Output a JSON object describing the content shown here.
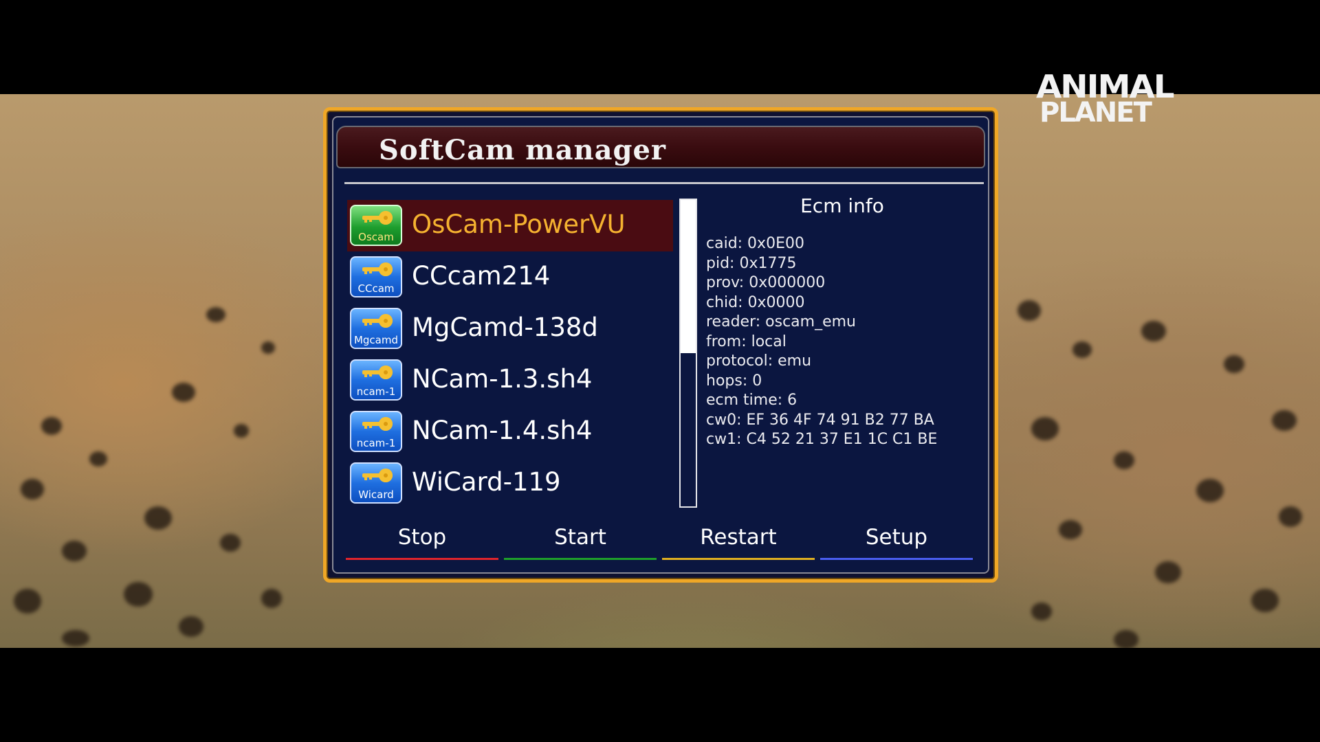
{
  "channel_logo": {
    "line1": "ANIMAL",
    "line2": "PLANET"
  },
  "dialog": {
    "title": "SoftCam manager",
    "cams": [
      {
        "name": "OsCam-PowerVU",
        "icon_label": "Oscam",
        "icon": "key-icon",
        "icon_color": "#1e9e2e",
        "selected": true
      },
      {
        "name": "CCcam214",
        "icon_label": "CCcam",
        "icon": "key-icon",
        "icon_color": "#1f6fe0",
        "selected": false
      },
      {
        "name": "MgCamd-138d",
        "icon_label": "Mgcamd",
        "icon": "key-icon",
        "icon_color": "#1f6fe0",
        "selected": false
      },
      {
        "name": "NCam-1.3.sh4",
        "icon_label": "ncam-1",
        "icon": "key-icon",
        "icon_color": "#1f6fe0",
        "selected": false
      },
      {
        "name": "NCam-1.4.sh4",
        "icon_label": "ncam-1",
        "icon": "key-icon",
        "icon_color": "#1f6fe0",
        "selected": false
      },
      {
        "name": "WiCard-119",
        "icon_label": "Wicard",
        "icon": "key-icon",
        "icon_color": "#1f6fe0",
        "selected": false
      }
    ],
    "scroll_position": 0.5,
    "ecm_info": {
      "title": "Ecm info",
      "lines": [
        "caid: 0x0E00",
        "pid: 0x1775",
        "prov: 0x000000",
        "chid: 0x0000",
        "reader: oscam_emu",
        "from: local",
        "protocol: emu",
        "hops: 0",
        "ecm time: 6",
        "cw0: EF 36 4F 74 91 B2 77 BA",
        "cw1: C4 52 21 37 E1 1C C1 BE"
      ]
    },
    "buttons": [
      {
        "label": "Stop",
        "color": "#e0242c"
      },
      {
        "label": "Start",
        "color": "#1ea02a"
      },
      {
        "label": "Restart",
        "color": "#e0b020"
      },
      {
        "label": "Setup",
        "color": "#4a5ef0"
      }
    ],
    "accent_color": "#f0a726",
    "selected_text_color": "#f5b230",
    "selected_row_color": "#4a0c12"
  }
}
